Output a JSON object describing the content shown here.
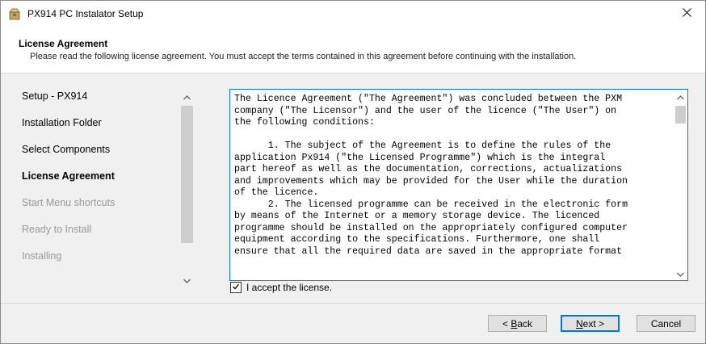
{
  "window": {
    "title": "PX914 PC Instalator Setup"
  },
  "header": {
    "title": "License Agreement",
    "subtitle": "Please read the following license agreement. You must accept the terms contained in this agreement before continuing with the installation."
  },
  "steps": [
    {
      "label": "Setup - PX914",
      "state": "done"
    },
    {
      "label": "Installation Folder",
      "state": "done"
    },
    {
      "label": "Select Components",
      "state": "done"
    },
    {
      "label": "License Agreement",
      "state": "current"
    },
    {
      "label": "Start Menu shortcuts",
      "state": "future"
    },
    {
      "label": "Ready to Install",
      "state": "future"
    },
    {
      "label": "Installing",
      "state": "future"
    }
  ],
  "license": {
    "text": "The Licence Agreement (\"The Agreement\") was concluded between the PXM\ncompany (\"The Licensor\") and the user of the licence (\"The User\") on\nthe following conditions:\n\n      1. The subject of the Agreement is to define the rules of the\napplication Px914 (\"the Licensed Programme\") which is the integral\npart hereof as well as the documentation, corrections, actualizations\nand improvements which may be provided for the User while the duration\nof the licence.\n      2. The licensed programme can be received in the electronic form\nby means of the Internet or a memory storage device. The licenced\nprogramme should be installed on the appropriately configured computer\nequipment according to the specifications. Furthermore, one shall\nensure that all the required data are saved in the appropriate format"
  },
  "accept": {
    "label": "I accept the license.",
    "checked": true
  },
  "buttons": {
    "back": "Back",
    "next": "Next >",
    "cancel": "Cancel"
  },
  "icons": {
    "app": "installer-box-icon",
    "close": "close-icon"
  }
}
